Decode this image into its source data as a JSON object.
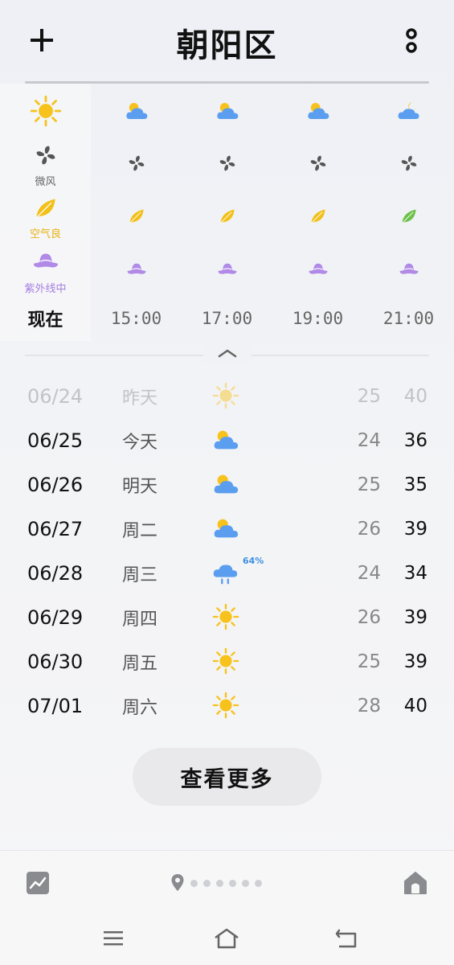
{
  "header": {
    "title": "朝阳区",
    "add_icon": "plus-icon",
    "more_icon": "more-vertical-icon"
  },
  "hourly": [
    {
      "time": "现在",
      "weather": "sunny-icon",
      "wind": "微风",
      "air": "空气良",
      "uv": "紫外线中",
      "current": true
    },
    {
      "time": "15:00",
      "weather": "partly-cloudy-icon"
    },
    {
      "time": "17:00",
      "weather": "partly-cloudy-icon"
    },
    {
      "time": "19:00",
      "weather": "partly-cloudy-icon"
    },
    {
      "time": "21:00",
      "weather": "cloudy-night-icon"
    }
  ],
  "daily": [
    {
      "date": "06/24",
      "day": "昨天",
      "weather": "sunny-icon",
      "low": "25",
      "high": "40",
      "past": true
    },
    {
      "date": "06/25",
      "day": "今天",
      "weather": "partly-cloudy-icon",
      "low": "24",
      "high": "36"
    },
    {
      "date": "06/26",
      "day": "明天",
      "weather": "partly-cloudy-icon",
      "low": "25",
      "high": "35"
    },
    {
      "date": "06/27",
      "day": "周二",
      "weather": "partly-cloudy-icon",
      "low": "26",
      "high": "39"
    },
    {
      "date": "06/28",
      "day": "周三",
      "weather": "rain-icon",
      "precip": "64%",
      "low": "24",
      "high": "34"
    },
    {
      "date": "06/29",
      "day": "周四",
      "weather": "sunny-icon",
      "low": "26",
      "high": "39"
    },
    {
      "date": "06/30",
      "day": "周五",
      "weather": "sunny-icon",
      "low": "25",
      "high": "39"
    },
    {
      "date": "07/01",
      "day": "周六",
      "weather": "sunny-icon",
      "low": "28",
      "high": "40"
    }
  ],
  "more_button": "查看更多",
  "colors": {
    "sun": "#f7c21b",
    "cloud": "#5b9ef0",
    "wind": "#555555",
    "air_good": "#f2c018",
    "air_excellent": "#6cc14a",
    "uv": "#b08ae6"
  },
  "bottom": {
    "trend_icon": "trend-chart-icon",
    "location_icon": "location-pin-icon",
    "home_icon": "home-icon",
    "page_count": 6
  },
  "nav": {
    "menu_icon": "menu-icon",
    "home_icon": "home-outline-icon",
    "back_icon": "back-icon"
  }
}
